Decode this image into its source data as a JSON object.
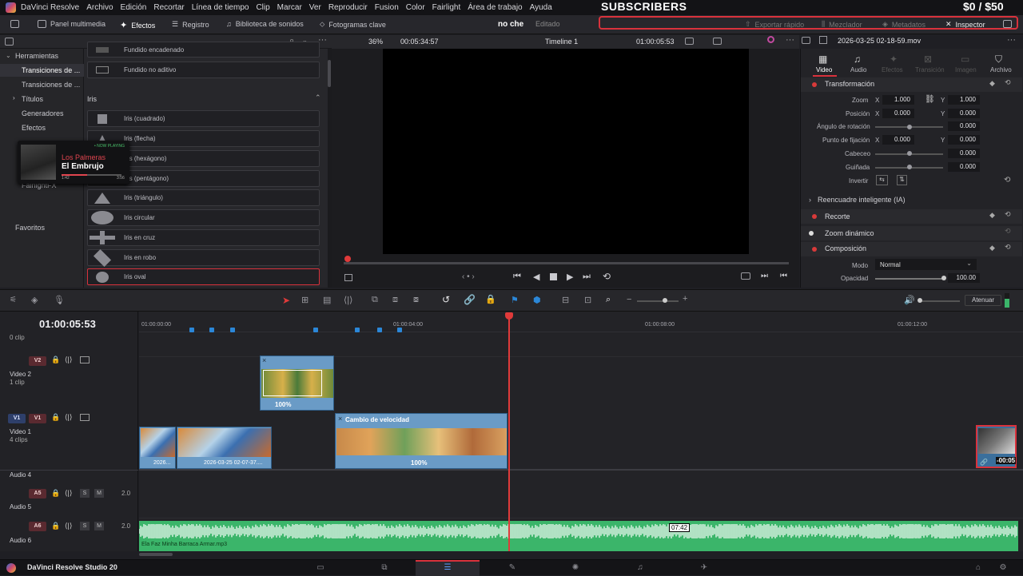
{
  "menubar": {
    "app": "DaVinci Resolve",
    "items": [
      "Archivo",
      "Edición",
      "Recortar",
      "Línea de tiempo",
      "Clip",
      "Marcar",
      "Ver",
      "Reproducir",
      "Fusion",
      "Color",
      "Fairlight",
      "Área de trabajo",
      "Ayuda"
    ],
    "overlay_subscribers": "SUBSCRIBERS",
    "overlay_money": "$0 / $50"
  },
  "toolbar": {
    "panel": "Panel multimedia",
    "efectos": "Efectos",
    "registro": "Registro",
    "sonidos": "Biblioteca de sonidos",
    "fotogramas": "Fotogramas clave",
    "project": "no che",
    "status": "Editado",
    "exportar": "Exportar rápido",
    "mezclador": "Mezclador",
    "metadatos": "Metadatos",
    "inspector": "Inspector"
  },
  "leftnav": {
    "herramientas": "Herramientas",
    "transiciones_video": "Transiciones de ...",
    "transiciones_audio": "Transiciones de ...",
    "titulos": "Títulos",
    "generadores": "Generadores",
    "efectos": "Efectos",
    "fairlight": "FairlightFX",
    "favoritos": "Favoritos"
  },
  "effects": {
    "top_items": [
      "Fundido encadenado",
      "Fundido no aditivo"
    ],
    "group": "Iris",
    "items": [
      "Iris (cuadrado)",
      "Iris (flecha)",
      "Iris (hexágono)",
      "Iris (pentágono)",
      "Iris (triángulo)",
      "Iris circular",
      "Iris en cruz",
      "Iris en robo",
      "Iris oval"
    ]
  },
  "nowplaying": {
    "badge": "• NOW PLAYING",
    "artist": "Los Palmeras",
    "title": "El Embrujo",
    "elapsed": "1:42",
    "total": "3:56"
  },
  "viewer": {
    "zoom": "36%",
    "source_tc": "00:05:34:57",
    "timeline": "Timeline 1",
    "timecode": "01:00:05:53",
    "filename": "2026-03-25 02-18-59.mov"
  },
  "inspector": {
    "tabs": [
      "Video",
      "Audio",
      "Efectos",
      "Transición",
      "Imagen",
      "Archivo"
    ],
    "transform": "Transformación",
    "zoom_label": "Zoom",
    "zoom_x": "1.000",
    "zoom_y": "1.000",
    "pos_label": "Posición",
    "pos_x": "0.000",
    "pos_y": "0.000",
    "angle_label": "Ángulo de rotación",
    "angle": "0.000",
    "anchor_label": "Punto de fijación",
    "anchor_x": "0.000",
    "anchor_y": "0.000",
    "pitch_label": "Cabeceo",
    "pitch": "0.000",
    "yaw_label": "Guiñada",
    "yaw": "0.000",
    "flip_label": "Invertir",
    "reframe": "Reencuadre inteligente (IA)",
    "crop": "Recorte",
    "dynzoom": "Zoom dinámico",
    "composite": "Composición",
    "mode_label": "Modo",
    "mode": "Normal",
    "opacity_label": "Opacidad",
    "opacity": "100.00",
    "x": "X",
    "y": "Y"
  },
  "timeline": {
    "timecode": "01:00:05:53",
    "attenuate": "Atenuar",
    "ruler": [
      "01:00:00:00",
      "01:00:04:00",
      "01:00:08:00",
      "01:00:12:00"
    ],
    "tracks": {
      "top_clips": "0 clip",
      "v2": "V2",
      "video2": "Video 2",
      "video2_clips": "1 clip",
      "v1a": "V1",
      "v1b": "V1",
      "video1": "Video 1",
      "video1_clips": "4 clips",
      "audio4": "Audio 4",
      "a5": "A5",
      "audio5": "Audio 5",
      "a6": "A6",
      "audio6": "Audio 6",
      "s": "S",
      "m": "M",
      "level": "2.0"
    },
    "clips": {
      "v2_speed": "100%",
      "speed_title": "Cambio de velocidad",
      "speed_pct": "100%",
      "clip_a": "2026...",
      "clip_b": "2026-03-25 02-07-37....",
      "right_tc": "-00:05",
      "audio_name": "Ela Faz Minha Barraca Armar.mp3",
      "audio_tc": "07:42"
    }
  },
  "pagebar": {
    "brand": "DaVinci Resolve Studio 20"
  },
  "colors": {
    "accent_red": "#d9323c",
    "audio_green": "#3bb56a",
    "clip_blue": "#6a9bc6"
  }
}
